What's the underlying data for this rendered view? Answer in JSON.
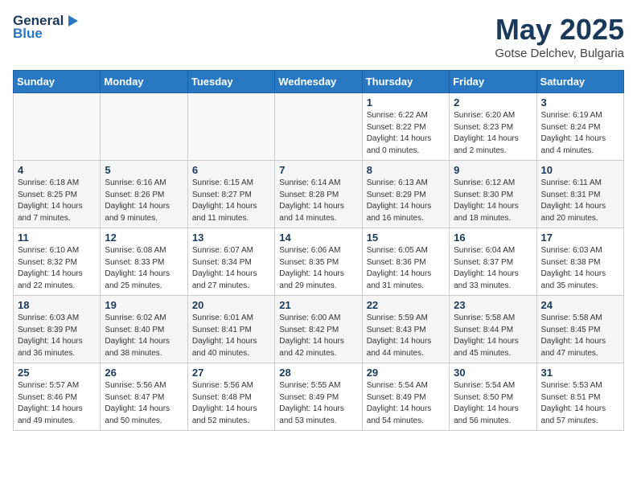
{
  "header": {
    "logo_line1": "General",
    "logo_line2": "Blue",
    "month": "May 2025",
    "location": "Gotse Delchev, Bulgaria"
  },
  "days_of_week": [
    "Sunday",
    "Monday",
    "Tuesday",
    "Wednesday",
    "Thursday",
    "Friday",
    "Saturday"
  ],
  "weeks": [
    [
      {
        "day": "",
        "content": ""
      },
      {
        "day": "",
        "content": ""
      },
      {
        "day": "",
        "content": ""
      },
      {
        "day": "",
        "content": ""
      },
      {
        "day": "1",
        "content": "Sunrise: 6:22 AM\nSunset: 8:22 PM\nDaylight: 14 hours\nand 0 minutes."
      },
      {
        "day": "2",
        "content": "Sunrise: 6:20 AM\nSunset: 8:23 PM\nDaylight: 14 hours\nand 2 minutes."
      },
      {
        "day": "3",
        "content": "Sunrise: 6:19 AM\nSunset: 8:24 PM\nDaylight: 14 hours\nand 4 minutes."
      }
    ],
    [
      {
        "day": "4",
        "content": "Sunrise: 6:18 AM\nSunset: 8:25 PM\nDaylight: 14 hours\nand 7 minutes."
      },
      {
        "day": "5",
        "content": "Sunrise: 6:16 AM\nSunset: 8:26 PM\nDaylight: 14 hours\nand 9 minutes."
      },
      {
        "day": "6",
        "content": "Sunrise: 6:15 AM\nSunset: 8:27 PM\nDaylight: 14 hours\nand 11 minutes."
      },
      {
        "day": "7",
        "content": "Sunrise: 6:14 AM\nSunset: 8:28 PM\nDaylight: 14 hours\nand 14 minutes."
      },
      {
        "day": "8",
        "content": "Sunrise: 6:13 AM\nSunset: 8:29 PM\nDaylight: 14 hours\nand 16 minutes."
      },
      {
        "day": "9",
        "content": "Sunrise: 6:12 AM\nSunset: 8:30 PM\nDaylight: 14 hours\nand 18 minutes."
      },
      {
        "day": "10",
        "content": "Sunrise: 6:11 AM\nSunset: 8:31 PM\nDaylight: 14 hours\nand 20 minutes."
      }
    ],
    [
      {
        "day": "11",
        "content": "Sunrise: 6:10 AM\nSunset: 8:32 PM\nDaylight: 14 hours\nand 22 minutes."
      },
      {
        "day": "12",
        "content": "Sunrise: 6:08 AM\nSunset: 8:33 PM\nDaylight: 14 hours\nand 25 minutes."
      },
      {
        "day": "13",
        "content": "Sunrise: 6:07 AM\nSunset: 8:34 PM\nDaylight: 14 hours\nand 27 minutes."
      },
      {
        "day": "14",
        "content": "Sunrise: 6:06 AM\nSunset: 8:35 PM\nDaylight: 14 hours\nand 29 minutes."
      },
      {
        "day": "15",
        "content": "Sunrise: 6:05 AM\nSunset: 8:36 PM\nDaylight: 14 hours\nand 31 minutes."
      },
      {
        "day": "16",
        "content": "Sunrise: 6:04 AM\nSunset: 8:37 PM\nDaylight: 14 hours\nand 33 minutes."
      },
      {
        "day": "17",
        "content": "Sunrise: 6:03 AM\nSunset: 8:38 PM\nDaylight: 14 hours\nand 35 minutes."
      }
    ],
    [
      {
        "day": "18",
        "content": "Sunrise: 6:03 AM\nSunset: 8:39 PM\nDaylight: 14 hours\nand 36 minutes."
      },
      {
        "day": "19",
        "content": "Sunrise: 6:02 AM\nSunset: 8:40 PM\nDaylight: 14 hours\nand 38 minutes."
      },
      {
        "day": "20",
        "content": "Sunrise: 6:01 AM\nSunset: 8:41 PM\nDaylight: 14 hours\nand 40 minutes."
      },
      {
        "day": "21",
        "content": "Sunrise: 6:00 AM\nSunset: 8:42 PM\nDaylight: 14 hours\nand 42 minutes."
      },
      {
        "day": "22",
        "content": "Sunrise: 5:59 AM\nSunset: 8:43 PM\nDaylight: 14 hours\nand 44 minutes."
      },
      {
        "day": "23",
        "content": "Sunrise: 5:58 AM\nSunset: 8:44 PM\nDaylight: 14 hours\nand 45 minutes."
      },
      {
        "day": "24",
        "content": "Sunrise: 5:58 AM\nSunset: 8:45 PM\nDaylight: 14 hours\nand 47 minutes."
      }
    ],
    [
      {
        "day": "25",
        "content": "Sunrise: 5:57 AM\nSunset: 8:46 PM\nDaylight: 14 hours\nand 49 minutes."
      },
      {
        "day": "26",
        "content": "Sunrise: 5:56 AM\nSunset: 8:47 PM\nDaylight: 14 hours\nand 50 minutes."
      },
      {
        "day": "27",
        "content": "Sunrise: 5:56 AM\nSunset: 8:48 PM\nDaylight: 14 hours\nand 52 minutes."
      },
      {
        "day": "28",
        "content": "Sunrise: 5:55 AM\nSunset: 8:49 PM\nDaylight: 14 hours\nand 53 minutes."
      },
      {
        "day": "29",
        "content": "Sunrise: 5:54 AM\nSunset: 8:49 PM\nDaylight: 14 hours\nand 54 minutes."
      },
      {
        "day": "30",
        "content": "Sunrise: 5:54 AM\nSunset: 8:50 PM\nDaylight: 14 hours\nand 56 minutes."
      },
      {
        "day": "31",
        "content": "Sunrise: 5:53 AM\nSunset: 8:51 PM\nDaylight: 14 hours\nand 57 minutes."
      }
    ]
  ]
}
